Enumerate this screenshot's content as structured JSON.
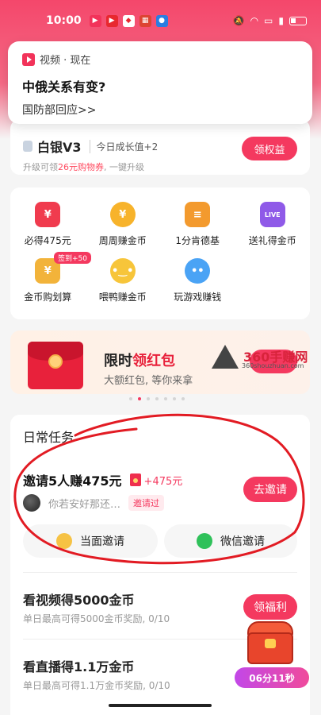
{
  "status_bar": {
    "time": "10:00"
  },
  "notification": {
    "app_name": "视频 · 现在",
    "title": "中俄关系有变?",
    "body": "国防部回应>>"
  },
  "vip": {
    "level": "白银V3",
    "growth": "今日成长值+2",
    "upgrade_prefix": "升级可领",
    "upgrade_highlight": "26元购物券",
    "upgrade_suffix": ", 一键升级",
    "button": "领权益"
  },
  "grid": {
    "items": [
      {
        "label": "必得475元",
        "icon": "red-packet-icon",
        "color": "#f03b4e",
        "glyph": "¥"
      },
      {
        "label": "周周赚金币",
        "icon": "gold-coin-icon",
        "color": "#f7b32b",
        "glyph": "¥"
      },
      {
        "label": "1分肯德基",
        "icon": "burger-icon",
        "color": "#f39a2e",
        "glyph": "≡"
      },
      {
        "label": "送礼得金币",
        "icon": "live-tv-icon",
        "color": "#8f5ae8",
        "glyph": "LIVE"
      },
      {
        "label": "金币购划算",
        "icon": "coin-bag-icon",
        "color": "#f2b33a",
        "glyph": "¥",
        "tag": "签到+50"
      },
      {
        "label": "喂鸭赚金币",
        "icon": "duck-icon",
        "color": "#f7c53a",
        "glyph": "•‿•"
      },
      {
        "label": "玩游戏赚钱",
        "icon": "game-controller-icon",
        "color": "#4aa3f5",
        "glyph": "••"
      }
    ]
  },
  "banner": {
    "title_prefix": "限时",
    "title_highlight": "领红包",
    "subtitle": "大额红包, 等你来拿",
    "watermark_text": "360手赚网",
    "watermark_url": "360shouzhuan.com"
  },
  "tasks": {
    "header": "日常任务",
    "invite": {
      "title": "邀请5人赚475元",
      "reward": "+475元",
      "user_name": "你若安好那还…",
      "invited_tag": "邀请过",
      "button": "去邀请",
      "face_to_face": "当面邀请",
      "wechat": "微信邀请"
    },
    "video": {
      "title": "看视频得5000金币",
      "subtitle": "单日最高可得5000金币奖励,  0/10",
      "button": "领福利"
    },
    "live": {
      "title": "看直播得1.1万金币",
      "subtitle": "单日最高可得1.1万金币奖励,  0/10"
    }
  },
  "floating_chest": {
    "timer": "06分11秒"
  },
  "colors": {
    "primary": "#f4395f",
    "annotation_red": "#e21b23"
  }
}
